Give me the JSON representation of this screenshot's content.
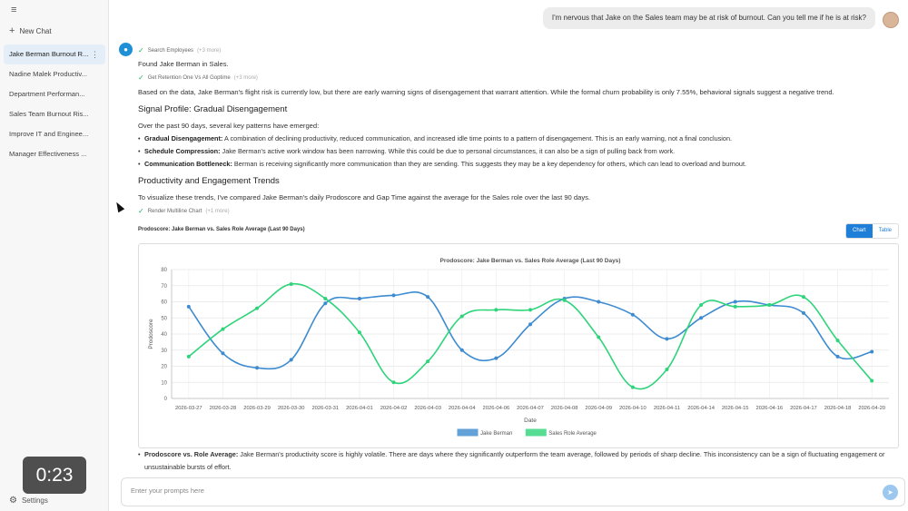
{
  "sidebar": {
    "new_chat_label": "New Chat",
    "items": [
      {
        "label": "Jake Berman Burnout R..."
      },
      {
        "label": "Nadine Malek Productiv..."
      },
      {
        "label": "Department Performan..."
      },
      {
        "label": "Sales Team Burnout Ris..."
      },
      {
        "label": "Improve IT and Enginee..."
      },
      {
        "label": "Manager Effectiveness ..."
      }
    ],
    "settings_label": "Settings",
    "timer": "0:23"
  },
  "conversation": {
    "user_message": "I'm nervous that Jake on the Sales team may be at risk of burnout. Can you tell me if he is at risk?",
    "tool1": {
      "label": "Search Employees",
      "more": "(+3 more)"
    },
    "found": "Found Jake Berman in Sales.",
    "tool2": {
      "label": "Get Retention One Vs All Goptime",
      "more": "(+3 more)"
    },
    "summary": "Based on the data, Jake Berman's flight risk is currently low, but there are early warning signs of disengagement that warrant attention. While the formal churn probability is only 7.55%, behavioral signals suggest a negative trend.",
    "signal_heading": "Signal Profile: Gradual Disengagement",
    "signal_intro": "Over the past 90 days, several key patterns have emerged:",
    "bullets": [
      {
        "title": "Gradual Disengagement:",
        "text": " A combination of declining productivity, reduced communication, and increased idle time points to a pattern of disengagement. This is an early warning, not a final conclusion."
      },
      {
        "title": "Schedule Compression:",
        "text": " Jake Berman's active work window has been narrowing. While this could be due to personal circumstances, it can also be a sign of pulling back from work."
      },
      {
        "title": "Communication Bottleneck:",
        "text": " Berman is receiving significantly more communication than they are sending. This suggests they may be a key dependency for others, which can lead to overload and burnout."
      }
    ],
    "trends_heading": "Productivity and Engagement Trends",
    "trends_intro": "To visualize these trends, I've compared Jake Berman's daily Prodoscore and Gap Time against the average for the Sales role over the last 90 days.",
    "tool3": {
      "label": "Render Multiline Chart",
      "more": "(+1 more)"
    },
    "chart_small_title": "Prodoscore: Jake Berman vs. Sales Role Average (Last 90 Days)",
    "toggle": {
      "chart": "Chart",
      "table": "Table"
    },
    "bottom_bullet_title": "Prodoscore vs. Role Average:",
    "bottom_bullet_text": " Jake Berman's productivity score is highly volatile. There are days where they significantly outperform the team average, followed by periods of sharp decline. This inconsistency can be a sign of fluctuating engagement or unsustainable bursts of effort."
  },
  "prompt": {
    "placeholder": "Enter your prompts here"
  },
  "colors": {
    "accent": "#1e7fd9",
    "jake": "#3d8bd0",
    "role": "#2ed47a"
  },
  "chart_data": {
    "type": "line",
    "title": "Prodoscore: Jake Berman vs. Sales Role Average (Last 90 Days)",
    "xlabel": "Date",
    "ylabel": "Prodoscore",
    "ylim": [
      0,
      80
    ],
    "yticks": [
      0,
      10,
      20,
      30,
      40,
      50,
      60,
      70,
      80
    ],
    "grid": true,
    "legend": "bottom",
    "categories": [
      "2026-03-27",
      "2026-03-28",
      "2026-03-29",
      "2026-03-30",
      "2026-03-31",
      "2026-04-01",
      "2026-04-02",
      "2026-04-03",
      "2026-04-04",
      "2026-04-06",
      "2026-04-07",
      "2026-04-08",
      "2026-04-09",
      "2026-04-10",
      "2026-04-11",
      "2026-04-14",
      "2026-04-15",
      "2026-04-16",
      "2026-04-17",
      "2026-04-18",
      "2026-04-20"
    ],
    "series": [
      {
        "name": "Jake Berman",
        "color": "#3d8bd0",
        "values": [
          57,
          28,
          19,
          24,
          59,
          62,
          64,
          63,
          30,
          25,
          46,
          62,
          60,
          52,
          37,
          50,
          60,
          58,
          53,
          26,
          29
        ]
      },
      {
        "name": "Sales Role Average",
        "color": "#2ed47a",
        "values": [
          26,
          43,
          56,
          71,
          62,
          41,
          10,
          23,
          51,
          55,
          55,
          61,
          38,
          7,
          18,
          58,
          57,
          58,
          63,
          36,
          11
        ]
      }
    ]
  }
}
